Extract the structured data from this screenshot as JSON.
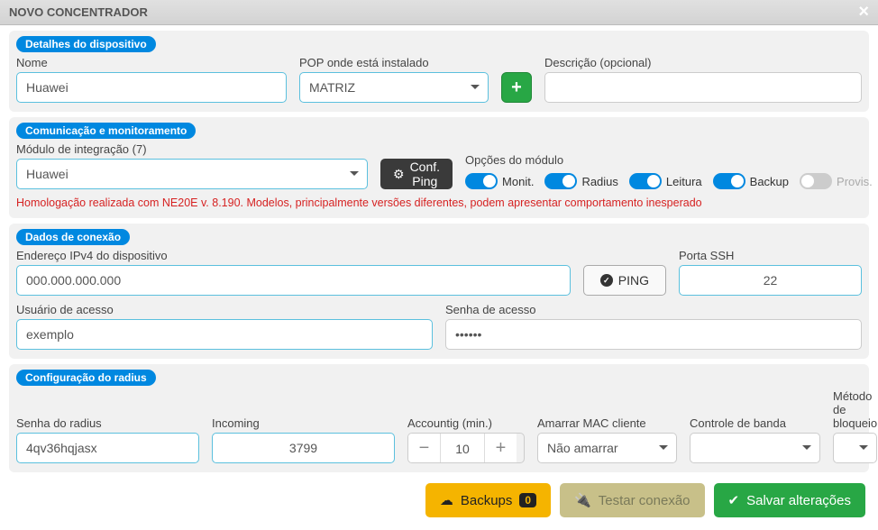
{
  "header": {
    "title": "NOVO CONCENTRADOR"
  },
  "s1": {
    "badge": "Detalhes do dispositivo",
    "nome_label": "Nome",
    "nome_value": "Huawei",
    "pop_label": "POP onde está instalado",
    "pop_value": "MATRIZ",
    "desc_label": "Descrição (opcional)",
    "desc_value": ""
  },
  "s2": {
    "badge": "Comunicação e monitoramento",
    "modulo_label": "Módulo de integração (7)",
    "modulo_value": "Huawei",
    "conf_ping": "Conf. Ping",
    "opcoes_label": "Opções do módulo",
    "toggles": {
      "monit": "Monit.",
      "radius": "Radius",
      "leitura": "Leitura",
      "backup": "Backup",
      "provis": "Provis."
    },
    "warn": "Homologação realizada com NE20E v. 8.190. Modelos, principalmente versões diferentes, podem apresentar comportamento inesperado"
  },
  "s3": {
    "badge": "Dados de conexão",
    "ipv4_label": "Endereço IPv4 do dispositivo",
    "ipv4_value": "000.000.000.000",
    "ping": "PING",
    "ssh_label": "Porta SSH",
    "ssh_value": "22",
    "user_label": "Usuário de acesso",
    "user_value": "exemplo",
    "pass_label": "Senha de acesso",
    "pass_value": "••••••"
  },
  "s4": {
    "badge": "Configuração do radius",
    "senha_label": "Senha do radius",
    "senha_value": "4qv36hqjasx",
    "incoming_label": "Incoming",
    "incoming_value": "3799",
    "acc_label": "Accountig (min.)",
    "acc_value": "10",
    "mac_label": "Amarrar MAC cliente",
    "mac_value": "Não amarrar",
    "banda_label": "Controle de banda",
    "banda_value": "",
    "bloq_label": "Método de bloqueio",
    "bloq_value": ""
  },
  "footer": {
    "backups": "Backups",
    "backups_count": "0",
    "testar": "Testar conexão",
    "salvar": "Salvar alterações"
  }
}
